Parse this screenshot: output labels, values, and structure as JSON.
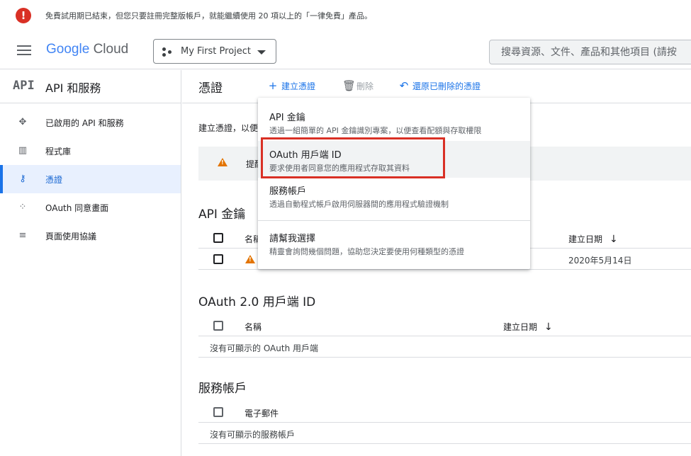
{
  "banner": {
    "text": "免費試用期已結束，但您只要註冊完整版帳戶，就能繼續使用 20 項以上的「一律免費」產品。",
    "icon": "error-icon",
    "color": "#d93025"
  },
  "header": {
    "logo": {
      "google": "Google",
      "cloud": "Cloud"
    },
    "project": "My First Project",
    "search_placeholder": "搜尋資源、文件、產品和其他項目 (請按"
  },
  "sidebar": {
    "mark": "API",
    "title": "API 和服務",
    "items": [
      {
        "label": "已啟用的 API 和服務",
        "icon": "api-nodes-icon",
        "active": false
      },
      {
        "label": "程式庫",
        "icon": "library-icon",
        "active": false
      },
      {
        "label": "憑證",
        "icon": "key-icon",
        "active": true
      },
      {
        "label": "OAuth 同意畫面",
        "icon": "consent-icon",
        "active": false
      },
      {
        "label": "頁面使用協議",
        "icon": "settings-list-icon",
        "active": false
      }
    ]
  },
  "toolbar": {
    "title": "憑證",
    "create": "建立憑證",
    "delete": "刪除",
    "restore": "還原已刪除的憑證"
  },
  "main": {
    "intro": "建立憑證，以便",
    "notice": "提醒"
  },
  "api_keys": {
    "title": "API 金鑰",
    "headers": {
      "name": "名稱",
      "created": "建立日期"
    },
    "rows": [
      {
        "created": "2020年5月14日"
      }
    ]
  },
  "oauth": {
    "title": "OAuth 2.0 用戶端 ID",
    "headers": {
      "name": "名稱",
      "created": "建立日期"
    },
    "empty": "沒有可顯示的 OAuth 用戶端"
  },
  "service_accounts": {
    "title": "服務帳戶",
    "headers": {
      "email": "電子郵件"
    },
    "empty": "沒有可顯示的服務帳戶"
  },
  "dropdown": {
    "items": [
      {
        "title": "API 金鑰",
        "desc": "透過一組簡單的 API 金鑰識別專案，以便查看配額與存取權限"
      },
      {
        "title": "OAuth 用戶端 ID",
        "desc": "要求使用者同意您的應用程式存取其資料",
        "highlighted": true
      },
      {
        "title": "服務帳戶",
        "desc": "透過自動程式帳戶啟用伺服器間的應用程式驗證機制"
      },
      {
        "title": "請幫我選擇",
        "desc": "精靈會詢問幾個問題，協助您決定要使用何種類型的憑證"
      }
    ]
  },
  "colors": {
    "accent": "#1a73e8",
    "active_bg": "#e8f0fe",
    "highlight_box": "#d93025",
    "warning": "#e37400"
  }
}
